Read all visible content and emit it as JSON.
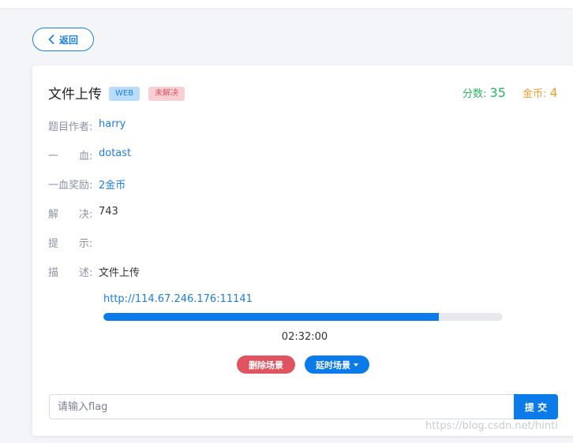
{
  "back_button": {
    "label": "返回"
  },
  "challenge": {
    "title": "文件上传",
    "category_badge": "WEB",
    "status_badge": "未解决",
    "score_label": "分数:",
    "score_value": "35",
    "coins_label": "金币:",
    "coins_value": "4"
  },
  "details": [
    {
      "label": "题目作者:",
      "value": "harry"
    },
    {
      "label": "一　　血:",
      "value": "dotast"
    },
    {
      "label": "一血奖励:",
      "value": "2金币"
    },
    {
      "label": "解　　决:",
      "value": "743"
    },
    {
      "label": "提　　示:",
      "value": ""
    },
    {
      "label": "描　　述:",
      "value": "文件上传"
    }
  ],
  "environment": {
    "url": "http://114.67.246.176:11141",
    "progress_fraction": 0.84,
    "timer": "02:32:00",
    "delete_label": "删除场景",
    "extend_label": "延时场景"
  },
  "flag_form": {
    "placeholder": "请输入flag",
    "value": "",
    "submit_label": "提 交"
  },
  "watermark": "https://blog.csdn.net/hinti",
  "colors": {
    "primary": "#0a7be8",
    "danger": "#e05461",
    "score": "#2ab565",
    "coins": "#f2a031"
  }
}
